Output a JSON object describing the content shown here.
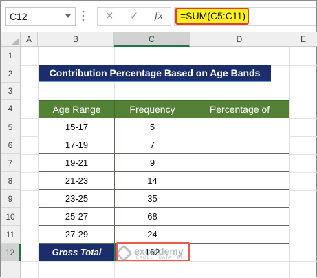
{
  "formula_bar": {
    "name_box": "C12",
    "cancel_icon": "✕",
    "enter_icon": "✓",
    "fx_label": "fx",
    "formula": "=SUM(C5:C11)"
  },
  "columns": [
    "A",
    "B",
    "C",
    "D",
    "E"
  ],
  "selected_column": "C",
  "rows": [
    "1",
    "2",
    "3",
    "4",
    "5",
    "6",
    "7",
    "8",
    "9",
    "10",
    "11",
    "12"
  ],
  "selected_row": "12",
  "sheet": {
    "title": "Contribution Percentage Based on Age Bands",
    "headers": [
      "Age Range",
      "Frequency",
      "Percentage of"
    ],
    "data": [
      {
        "age": "15-17",
        "freq": "5"
      },
      {
        "age": "17-19",
        "freq": "7"
      },
      {
        "age": "19-21",
        "freq": "9"
      },
      {
        "age": "21-23",
        "freq": "14"
      },
      {
        "age": "23-25",
        "freq": "35"
      },
      {
        "age": "25-27",
        "freq": "68"
      },
      {
        "age": "27-29",
        "freq": "24"
      }
    ],
    "gross_total_label": "Gross Total",
    "gross_total_value": "162"
  },
  "watermark": {
    "name": "exceldemy",
    "tagline": "EXCEL · DATA · BI"
  },
  "colors": {
    "title_bg": "#1b2e6b",
    "header_bg": "#538135",
    "formula_highlight": "#fff21c",
    "highlight_border": "#e23b2f",
    "excel_green": "#217346"
  }
}
